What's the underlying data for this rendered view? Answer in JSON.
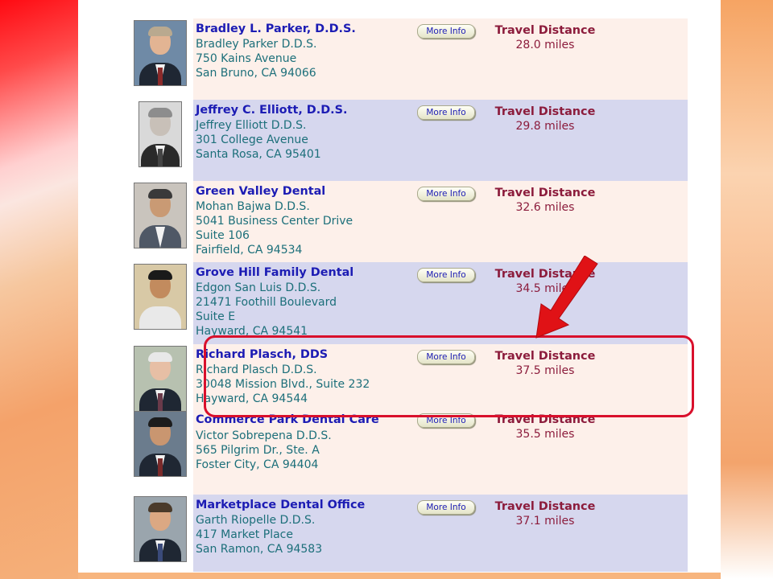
{
  "more_info_label": "More Info",
  "travel_distance_label": "Travel Distance",
  "listings": [
    {
      "name": "Bradley L. Parker, D.D.S.",
      "lines": [
        "Bradley Parker D.D.S.",
        "750 Kains Avenue",
        "San Bruno, CA 94066"
      ],
      "distance": "28.0 miles",
      "photo": "dentist-photo-bradley-parker"
    },
    {
      "name": "Jeffrey C. Elliott, D.D.S.",
      "lines": [
        "Jeffrey Elliott D.D.S.",
        "301 College Avenue",
        "Santa Rosa, CA 95401"
      ],
      "distance": "29.8 miles",
      "photo": "dentist-photo-jeffrey-elliott"
    },
    {
      "name": "Green Valley Dental",
      "lines": [
        "Mohan Bajwa D.D.S.",
        "5041 Business Center Drive",
        "Suite 106",
        "Fairfield, CA 94534"
      ],
      "distance": "32.6 miles",
      "photo": "dentist-photo-mohan-bajwa"
    },
    {
      "name": "Grove Hill Family Dental",
      "lines": [
        "Edgon San Luis D.D.S.",
        "21471 Foothill Boulevard",
        "Suite E",
        "Hayward, CA 94541"
      ],
      "distance": "34.5 miles",
      "photo": "dentist-photo-edgon-san-luis"
    },
    {
      "name": "Richard Plasch, DDS",
      "lines": [
        "Richard Plasch D.D.S.",
        "30048 Mission Blvd., Suite 232",
        "Hayward, CA 94544"
      ],
      "distance": "37.5 miles",
      "photo": "dentist-photo-richard-plasch"
    },
    {
      "name": "Commerce Park Dental Care",
      "lines": [
        "Victor Sobrepena D.D.S.",
        "565 Pilgrim Dr., Ste. A",
        "Foster City, CA 94404"
      ],
      "distance": "35.5 miles",
      "photo": "dentist-photo-victor-sobrepena"
    },
    {
      "name": "Marketplace Dental Office",
      "lines": [
        "Garth Riopelle D.D.S.",
        "417 Market Place",
        "San Ramon, CA 94583"
      ],
      "distance": "37.1 miles",
      "photo": "dentist-photo-garth-riopelle"
    }
  ],
  "colors": {
    "name": "#1c1cb4",
    "address": "#1c6f7a",
    "distance": "#8c1c3c",
    "highlight": "#d9102c",
    "row_light": "#fdf0ea",
    "row_blue": "#d6d7ee"
  }
}
